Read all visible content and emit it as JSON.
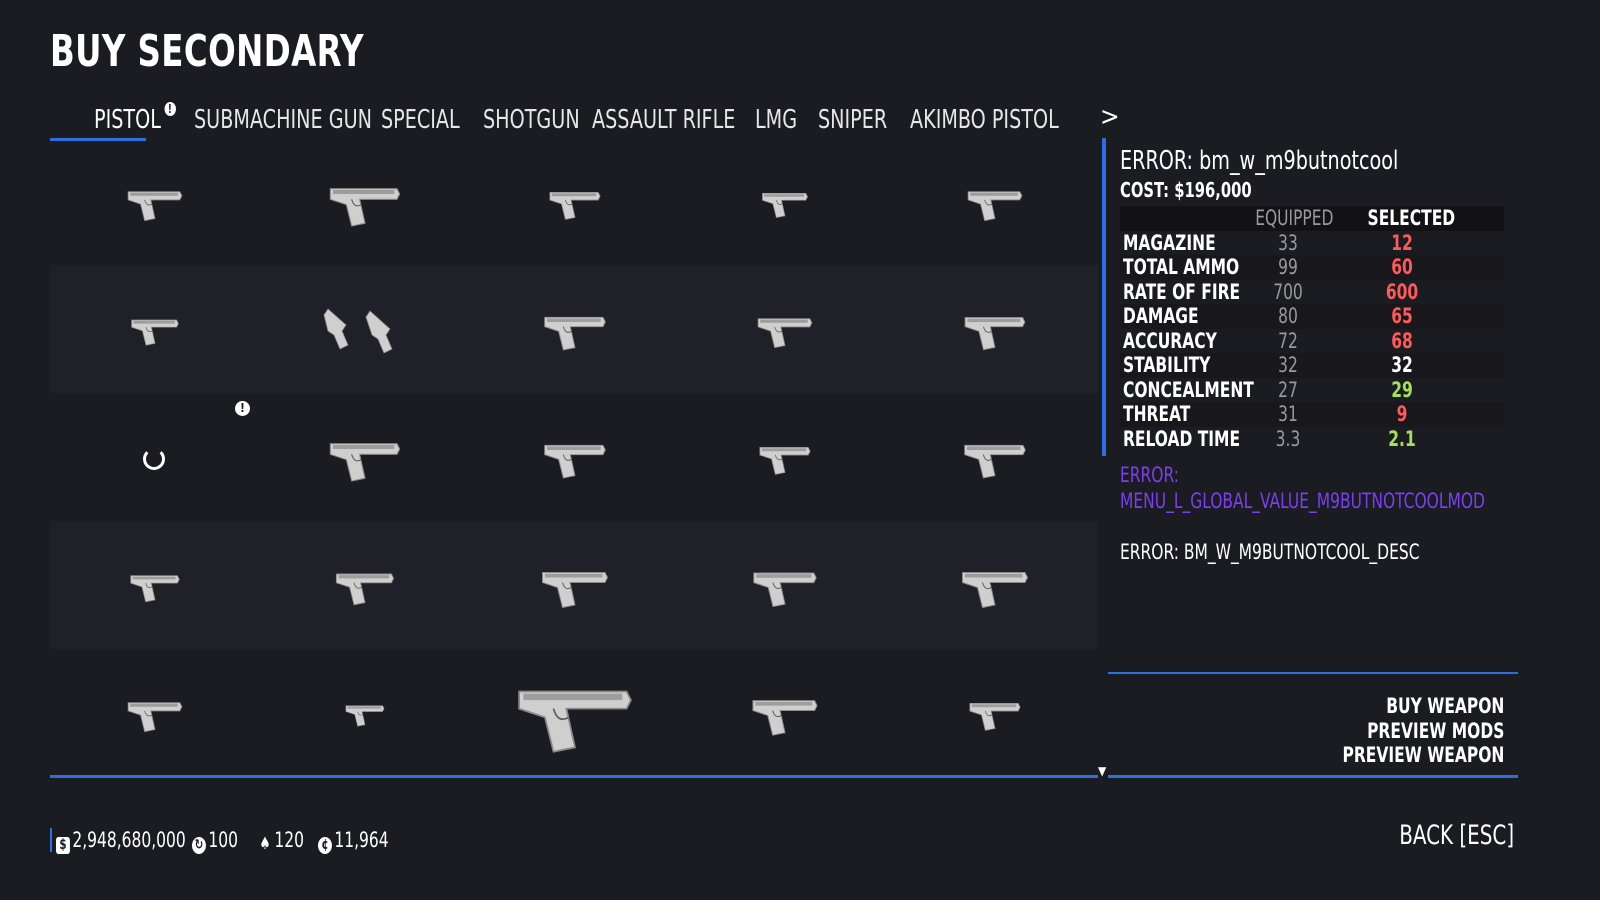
{
  "header": {
    "title": "BUY SECONDARY"
  },
  "tabs": [
    {
      "label": "PISTOL",
      "active": true,
      "alert": true
    },
    {
      "label": "SUBMACHINE GUN"
    },
    {
      "label": "SPECIAL"
    },
    {
      "label": "SHOTGUN"
    },
    {
      "label": "ASSAULT RIFLE"
    },
    {
      "label": "LMG"
    },
    {
      "label": "SNIPER"
    },
    {
      "label": "AKIMBO PISTOL"
    }
  ],
  "tab_next": ">",
  "grid_alert": "!",
  "info": {
    "name": "ERROR: bm_w_m9butnotcool",
    "cost": "COST: $196,000"
  },
  "stats": {
    "headers": {
      "equipped": "EQUIPPED",
      "selected": "SELECTED"
    },
    "rows": [
      {
        "label": "MAGAZINE",
        "equipped": "33",
        "selected": "12",
        "color": "#ff5a5a"
      },
      {
        "label": "TOTAL AMMO",
        "equipped": "99",
        "selected": "60",
        "color": "#ff5a5a"
      },
      {
        "label": "RATE OF FIRE",
        "equipped": "700",
        "selected": "600",
        "color": "#ff5a5a"
      },
      {
        "label": "DAMAGE",
        "equipped": "80",
        "selected": "65",
        "color": "#ff5a5a"
      },
      {
        "label": "ACCURACY",
        "equipped": "72",
        "selected": "68",
        "color": "#ff5a5a"
      },
      {
        "label": "STABILITY",
        "equipped": "32",
        "selected": "32",
        "color": "#ffffff"
      },
      {
        "label": "CONCEALMENT",
        "equipped": "27",
        "selected": "29",
        "color": "#a6e05a"
      },
      {
        "label": "THREAT",
        "equipped": "31",
        "selected": "9",
        "color": "#ff5a5a"
      },
      {
        "label": "RELOAD TIME",
        "equipped": "3.3",
        "selected": "2.1",
        "color": "#a6e05a"
      }
    ]
  },
  "errors": {
    "global_value": "ERROR: MENU_L_GLOBAL_VALUE_M9BUTNOTCOOLMOD",
    "description": "ERROR: BM_W_M9BUTNOTCOOL_DESC"
  },
  "actions": {
    "buy": "BUY WEAPON",
    "preview_mods": "PREVIEW MODS",
    "preview_weapon": "PREVIEW WEAPON"
  },
  "footer": {
    "money": "2,948,680,000",
    "coins": "100",
    "infamy": "120",
    "continental": "11,964",
    "back": "BACK [ESC]"
  },
  "colors": {
    "accent": "#2b6fe0",
    "error_purple": "#7b3ff0",
    "worse": "#ff5a5a",
    "better": "#a6e05a"
  }
}
